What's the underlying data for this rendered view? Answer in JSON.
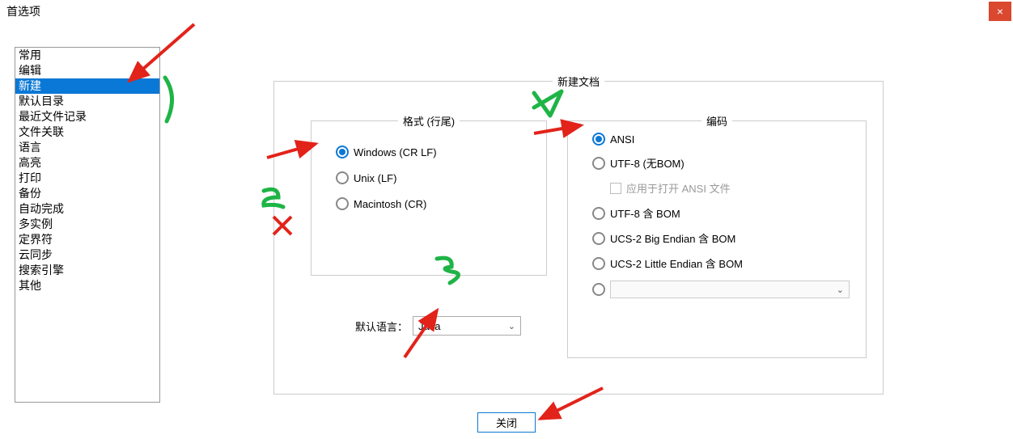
{
  "window": {
    "title": "首选项",
    "close_icon": "×"
  },
  "sidebar": {
    "items": [
      "常用",
      "编辑",
      "新建",
      "默认目录",
      "最近文件记录",
      "文件关联",
      "语言",
      "高亮",
      "打印",
      "备份",
      "自动完成",
      "多实例",
      "定界符",
      "云同步",
      "搜索引擎",
      "其他"
    ],
    "selected_index": 2
  },
  "outer": {
    "legend": "新建文档"
  },
  "format": {
    "legend": "格式 (行尾)",
    "options": [
      {
        "label": "Windows (CR LF)",
        "checked": true
      },
      {
        "label": "Unix (LF)",
        "checked": false
      },
      {
        "label": "Macintosh (CR)",
        "checked": false
      }
    ]
  },
  "encoding": {
    "legend": "编码",
    "options": [
      {
        "label": "ANSI",
        "checked": true
      },
      {
        "label": "UTF-8 (无BOM)",
        "checked": false
      },
      {
        "label": "UTF-8 含 BOM",
        "checked": false
      },
      {
        "label": "UCS-2 Big Endian 含 BOM",
        "checked": false
      },
      {
        "label": "UCS-2 Little Endian 含 BOM",
        "checked": false
      },
      {
        "label": "",
        "checked": false
      }
    ],
    "apply_checkbox": {
      "label": "应用于打开 ANSI 文件",
      "checked": false
    }
  },
  "default_language": {
    "label": "默认语言：",
    "value": "Java"
  },
  "footer": {
    "close": "关闭"
  }
}
